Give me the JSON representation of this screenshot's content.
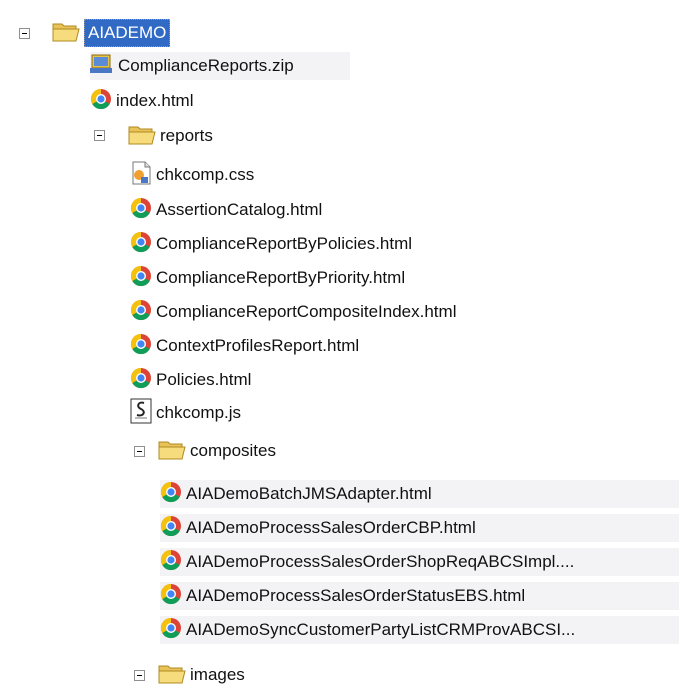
{
  "tree": {
    "root": {
      "label": "AIADEMO",
      "icon": "folder-open-icon"
    },
    "children": [
      {
        "label": "ComplianceReports.zip",
        "icon": "zip-archive-icon"
      },
      {
        "label": "index.html",
        "icon": "chrome-html-icon"
      }
    ],
    "reports": {
      "label": "reports",
      "icon": "folder-open-icon",
      "children": [
        {
          "label": "chkcomp.css",
          "icon": "css-file-icon"
        },
        {
          "label": "AssertionCatalog.html",
          "icon": "chrome-html-icon"
        },
        {
          "label": "ComplianceReportByPolicies.html",
          "icon": "chrome-html-icon"
        },
        {
          "label": "ComplianceReportByPriority.html",
          "icon": "chrome-html-icon"
        },
        {
          "label": "ComplianceReportCompositeIndex.html",
          "icon": "chrome-html-icon"
        },
        {
          "label": "ContextProfilesReport.html",
          "icon": "chrome-html-icon"
        },
        {
          "label": "Policies.html",
          "icon": "chrome-html-icon"
        },
        {
          "label": "chkcomp.js",
          "icon": "script-file-icon"
        }
      ],
      "composites": {
        "label": "composites",
        "icon": "folder-open-icon",
        "children": [
          {
            "label": "AIADemoBatchJMSAdapter.html",
            "icon": "chrome-html-icon"
          },
          {
            "label": "AIADemoProcessSalesOrderCBP.html",
            "icon": "chrome-html-icon"
          },
          {
            "label": "AIADemoProcessSalesOrderShopReqABCSImpl....",
            "icon": "chrome-html-icon"
          },
          {
            "label": "AIADemoProcessSalesOrderStatusEBS.html",
            "icon": "chrome-html-icon"
          },
          {
            "label": "AIADemoSyncCustomerPartyListCRMProvABCSI...",
            "icon": "chrome-html-icon"
          }
        ]
      },
      "images": {
        "label": "images",
        "icon": "folder-open-icon"
      }
    }
  }
}
